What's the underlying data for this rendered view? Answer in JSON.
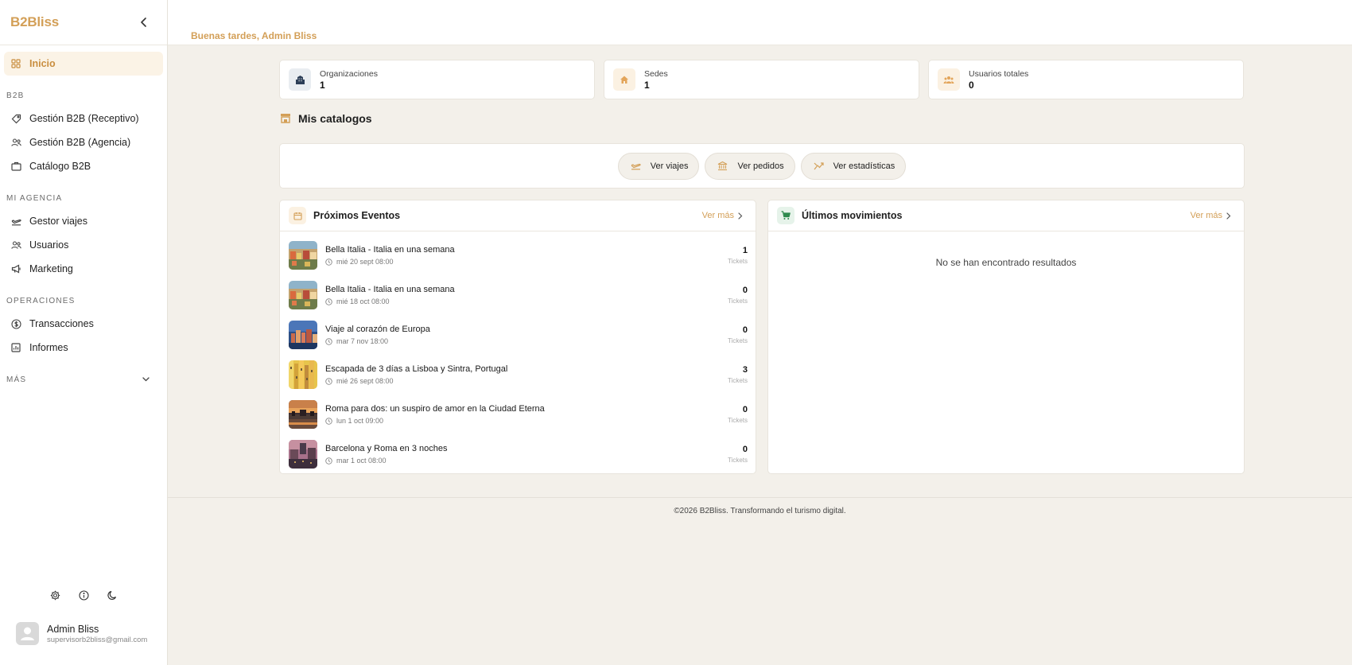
{
  "sidebar": {
    "brand": "B2Bliss",
    "items_main": [
      {
        "label": "Inicio",
        "icon": "grid-icon"
      }
    ],
    "section_b2b": "B2B",
    "items_b2b": [
      {
        "label": "Gestión B2B (Receptivo)",
        "icon": "tag-icon"
      },
      {
        "label": "Gestión B2B (Agencia)",
        "icon": "users-icon"
      },
      {
        "label": "Catálogo B2B",
        "icon": "briefcase-icon"
      }
    ],
    "section_agency": "MI AGENCIA",
    "items_agency": [
      {
        "label": "Gestor viajes",
        "icon": "plane-icon"
      },
      {
        "label": "Usuarios",
        "icon": "users-icon"
      },
      {
        "label": "Marketing",
        "icon": "megaphone-icon"
      }
    ],
    "section_ops": "OPERACIONES",
    "items_ops": [
      {
        "label": "Transacciones",
        "icon": "dollar-circle-icon"
      },
      {
        "label": "Informes",
        "icon": "report-icon"
      }
    ],
    "section_more": "MÁS",
    "user": {
      "name": "Admin Bliss",
      "email": "supervisorb2bliss@gmail.com"
    }
  },
  "header": {
    "greeting": "Buenas tardes, Admin Bliss"
  },
  "stats": [
    {
      "label": "Organizaciones",
      "value": "1"
    },
    {
      "label": "Sedes",
      "value": "1"
    },
    {
      "label": "Usuarios totales",
      "value": "0"
    }
  ],
  "catalog": {
    "title": "Mis catalogos"
  },
  "actions": [
    {
      "label": "Ver viajes"
    },
    {
      "label": "Ver pedidos"
    },
    {
      "label": "Ver estadísticas"
    }
  ],
  "events_panel": {
    "title": "Próximos Eventos",
    "see_more": "Ver más",
    "items": [
      {
        "title": "Bella Italia - Italia en una semana",
        "date": "mié 20 sept 08:00",
        "count": "1",
        "unit": "Tickets"
      },
      {
        "title": "Bella Italia - Italia en una semana",
        "date": "mié 18 oct 08:00",
        "count": "0",
        "unit": "Tickets"
      },
      {
        "title": "Viaje al corazón de Europa",
        "date": "mar 7 nov 18:00",
        "count": "0",
        "unit": "Tickets"
      },
      {
        "title": "Escapada de 3 días a Lisboa y Sintra, Portugal",
        "date": "mié 26 sept 08:00",
        "count": "3",
        "unit": "Tickets"
      },
      {
        "title": "Roma para dos: un suspiro de amor en la Ciudad Eterna",
        "date": "lun 1 oct 09:00",
        "count": "0",
        "unit": "Tickets"
      },
      {
        "title": "Barcelona y Roma en 3 noches",
        "date": "mar 1 oct 08:00",
        "count": "0",
        "unit": "Tickets"
      }
    ]
  },
  "movements_panel": {
    "title": "Últimos movimientos",
    "see_more": "Ver más",
    "empty": "No se han encontrado resultados"
  },
  "footer": {
    "text": "©2026 B2Bliss. Transformando el turismo digital."
  },
  "colors": {
    "accent": "#d39f57",
    "background": "#f3f0ea"
  }
}
